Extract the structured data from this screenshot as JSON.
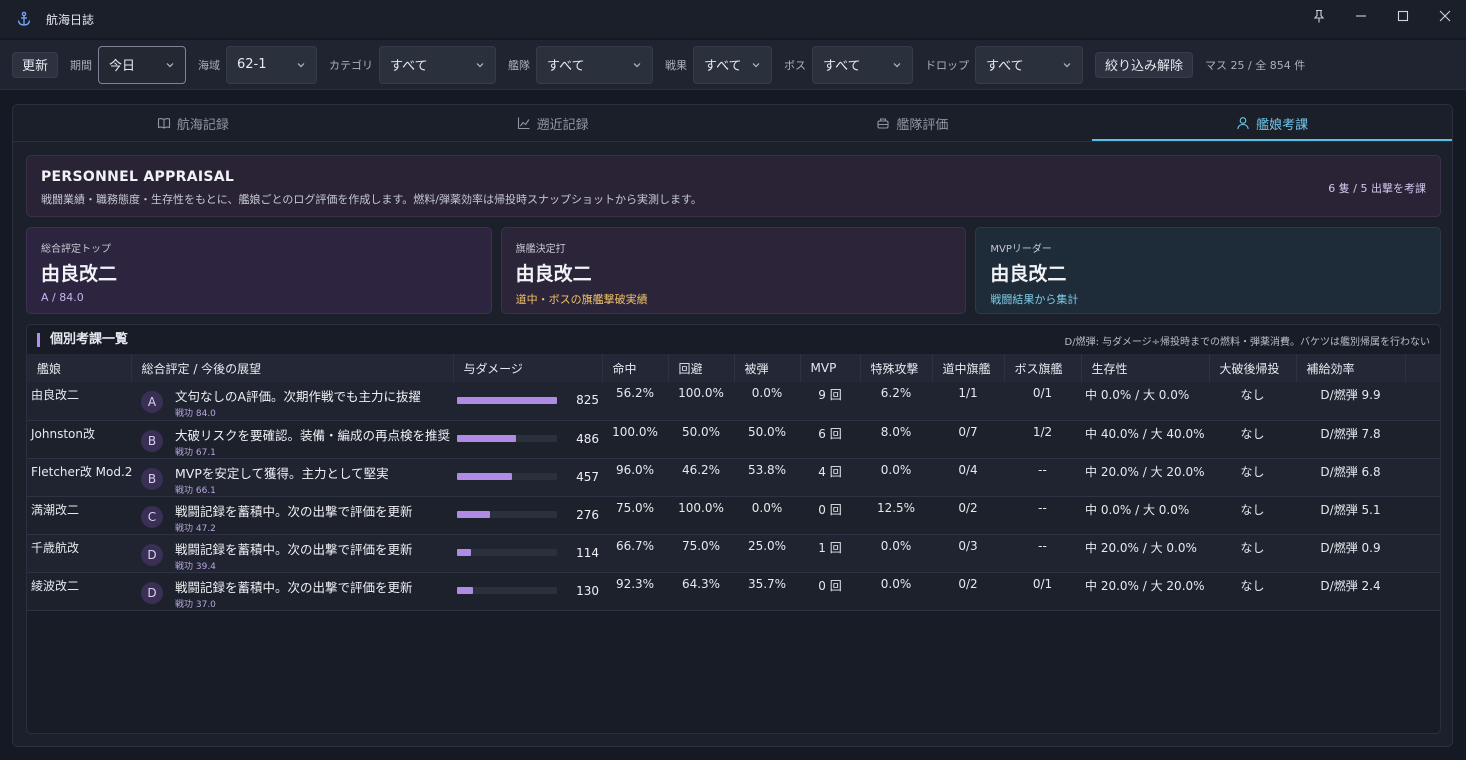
{
  "window": {
    "title": "航海日誌"
  },
  "toolbar": {
    "refresh_label": "更新",
    "filters": [
      {
        "label": "期間",
        "value": "今日"
      },
      {
        "label": "海域",
        "value": "62-1"
      },
      {
        "label": "カテゴリ",
        "value": "すべて"
      },
      {
        "label": "艦隊",
        "value": "すべて"
      },
      {
        "label": "戦果",
        "value": "すべて"
      },
      {
        "label": "ボス",
        "value": "すべて"
      },
      {
        "label": "ドロップ",
        "value": "すべて"
      }
    ],
    "clear_label": "絞り込み解除",
    "counter": "マス 25 / 全 854 件"
  },
  "tabs": [
    {
      "label": "航海記録",
      "icon": "book-icon"
    },
    {
      "label": "遡近記録",
      "icon": "chart-icon"
    },
    {
      "label": "艦隊評価",
      "icon": "fleet-icon"
    },
    {
      "label": "艦娘考課",
      "icon": "user-icon"
    }
  ],
  "banner": {
    "title": "PERSONNEL APPRAISAL",
    "desc": "戦闘業績・職務態度・生存性をもとに、艦娘ごとのログ評価を作成します。燃料/弾薬効率は帰投時スナップショットから実測します。",
    "count": "6 隻 / 5 出撃を考課"
  },
  "cards": [
    {
      "label": "総合評定トップ",
      "value": "由良改二",
      "sub": "A / 84.0"
    },
    {
      "label": "旗艦決定打",
      "value": "由良改二",
      "sub": "道中・ボスの旗艦撃破実績"
    },
    {
      "label": "MVPリーダー",
      "value": "由良改二",
      "sub": "戦闘結果から集計"
    }
  ],
  "table": {
    "title": "個別考課一覧",
    "note": "D/燃弾: 与ダメージ÷帰投時までの燃料・弾薬消費。バケツは艦別帰属を行わない",
    "columns": [
      "艦娘",
      "総合評定 / 今後の展望",
      "与ダメージ",
      "命中",
      "回避",
      "被弾",
      "MVP",
      "特殊攻撃",
      "道中旗艦",
      "ボス旗艦",
      "生存性",
      "大破後帰投",
      "補給効率"
    ],
    "rows": [
      {
        "name": "由良改二",
        "grade": "A",
        "eval": "文句なしのA評価。次期作戦でも主力に抜擢",
        "score": "戦功 84.0",
        "damage": 825,
        "damage_label": "825",
        "hit": "56.2%",
        "evade": "100.0%",
        "taken": "0.0%",
        "mvp": "9 回",
        "special": "6.2%",
        "route_flag": "1/1",
        "boss_flag": "0/1",
        "survival": "中 0.0% / 大 0.0%",
        "return": "なし",
        "efficiency": "D/燃弾 9.9"
      },
      {
        "name": "Johnston改",
        "grade": "B",
        "eval": "大破リスクを要確認。装備・編成の再点検を推奨",
        "score": "戦功 67.1",
        "damage": 486,
        "damage_label": "486",
        "hit": "100.0%",
        "evade": "50.0%",
        "taken": "50.0%",
        "mvp": "6 回",
        "special": "8.0%",
        "route_flag": "0/7",
        "boss_flag": "1/2",
        "survival": "中 40.0% / 大 40.0%",
        "return": "なし",
        "efficiency": "D/燃弾 7.8"
      },
      {
        "name": "Fletcher改 Mod.2",
        "grade": "B",
        "eval": "MVPを安定して獲得。主力として堅実",
        "score": "戦功 66.1",
        "damage": 457,
        "damage_label": "457",
        "hit": "96.0%",
        "evade": "46.2%",
        "taken": "53.8%",
        "mvp": "4 回",
        "special": "0.0%",
        "route_flag": "0/4",
        "boss_flag": "--",
        "survival": "中 20.0% / 大 20.0%",
        "return": "なし",
        "efficiency": "D/燃弾 6.8"
      },
      {
        "name": "満潮改二",
        "grade": "C",
        "eval": "戦闘記録を蓄積中。次の出撃で評価を更新",
        "score": "戦功 47.2",
        "damage": 276,
        "damage_label": "276",
        "hit": "75.0%",
        "evade": "100.0%",
        "taken": "0.0%",
        "mvp": "0 回",
        "special": "12.5%",
        "route_flag": "0/2",
        "boss_flag": "--",
        "survival": "中 0.0% / 大 0.0%",
        "return": "なし",
        "efficiency": "D/燃弾 5.1"
      },
      {
        "name": "千歳航改",
        "grade": "D",
        "eval": "戦闘記録を蓄積中。次の出撃で評価を更新",
        "score": "戦功 39.4",
        "damage": 114,
        "damage_label": "114",
        "hit": "66.7%",
        "evade": "75.0%",
        "taken": "25.0%",
        "mvp": "1 回",
        "special": "0.0%",
        "route_flag": "0/3",
        "boss_flag": "--",
        "survival": "中 20.0% / 大 0.0%",
        "return": "なし",
        "efficiency": "D/燃弾 0.9"
      },
      {
        "name": "綾波改二",
        "grade": "D",
        "eval": "戦闘記録を蓄積中。次の出撃で評価を更新",
        "score": "戦功 37.0",
        "damage": 130,
        "damage_label": "130",
        "hit": "92.3%",
        "evade": "64.3%",
        "taken": "35.7%",
        "mvp": "0 回",
        "special": "0.0%",
        "route_flag": "0/2",
        "boss_flag": "0/1",
        "survival": "中 20.0% / 大 20.0%",
        "return": "なし",
        "efficiency": "D/燃弾 2.4"
      }
    ],
    "damage_max": 825
  },
  "colors": {
    "accent": "#5bbde3",
    "bar": "#b08be6",
    "gold": "#f0c36a"
  }
}
